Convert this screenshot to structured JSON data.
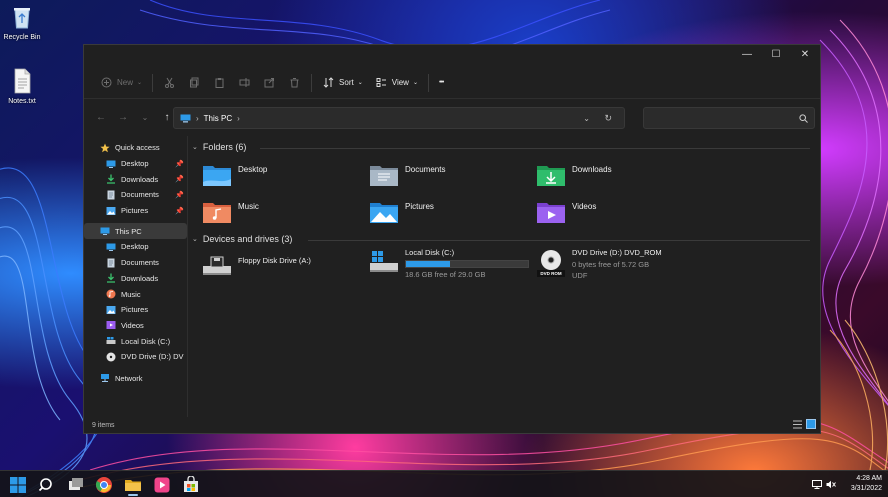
{
  "desktop": {
    "icons": [
      {
        "label": "Recycle Bin",
        "icon": "recycle-bin-icon"
      },
      {
        "label": "Notes.txt",
        "icon": "text-file-icon"
      }
    ]
  },
  "window": {
    "controls": {
      "minimize": "—",
      "maximize": "☐",
      "close": "✕"
    },
    "toolbar": {
      "new_label": "New",
      "sort_label": "Sort",
      "view_label": "View",
      "more_label": "•••"
    },
    "nav": {
      "back": "←",
      "forward": "→",
      "recent": "⌄",
      "up": "↑"
    },
    "address": {
      "chevron": "›",
      "location": "This PC",
      "trailing_chevron": "›",
      "dropdown": "⌄",
      "refresh": "↻"
    },
    "search": {
      "placeholder": "",
      "icon": "search-icon"
    },
    "sidebar": {
      "quick_access": {
        "label": "Quick access",
        "icon": "star-icon"
      },
      "quick_items": [
        {
          "label": "Desktop",
          "icon": "desktop-folder-icon",
          "pinned": true
        },
        {
          "label": "Downloads",
          "icon": "downloads-icon",
          "pinned": true
        },
        {
          "label": "Documents",
          "icon": "documents-icon",
          "pinned": true
        },
        {
          "label": "Pictures",
          "icon": "pictures-icon",
          "pinned": true
        }
      ],
      "this_pc": {
        "label": "This PC",
        "icon": "pc-icon"
      },
      "pc_items": [
        {
          "label": "Desktop",
          "icon": "desktop-folder-icon"
        },
        {
          "label": "Documents",
          "icon": "documents-icon"
        },
        {
          "label": "Downloads",
          "icon": "downloads-icon"
        },
        {
          "label": "Music",
          "icon": "music-icon"
        },
        {
          "label": "Pictures",
          "icon": "pictures-icon"
        },
        {
          "label": "Videos",
          "icon": "videos-icon"
        },
        {
          "label": "Local Disk (C:)",
          "icon": "drive-icon"
        },
        {
          "label": "DVD Drive (D:) DV",
          "icon": "dvd-icon"
        }
      ],
      "network": {
        "label": "Network",
        "icon": "network-icon"
      }
    },
    "folders": {
      "heading": "Folders (6)",
      "items": [
        {
          "label": "Desktop",
          "icon": "desktop-folder-icon"
        },
        {
          "label": "Documents",
          "icon": "documents-folder-icon"
        },
        {
          "label": "Downloads",
          "icon": "downloads-folder-icon"
        },
        {
          "label": "Music",
          "icon": "music-folder-icon"
        },
        {
          "label": "Pictures",
          "icon": "pictures-folder-icon"
        },
        {
          "label": "Videos",
          "icon": "videos-folder-icon"
        }
      ]
    },
    "drives": {
      "heading": "Devices and drives (3)",
      "items": [
        {
          "label": "Floppy Disk Drive (A:)",
          "icon": "floppy-drive-icon"
        },
        {
          "label": "Local Disk (C:)",
          "icon": "local-disk-icon",
          "free_text": "18.6 GB free of 29.0 GB",
          "used_fraction": 0.36
        },
        {
          "label": "DVD Drive (D:) DVD_ROM",
          "icon": "dvd-drive-icon",
          "free_text": "0 bytes free of 5.72 GB",
          "fs_text": "UDF",
          "badge": "DVD ROM"
        }
      ]
    },
    "status": {
      "items_count": "9 items"
    }
  },
  "taskbar": {
    "icons": [
      "start-icon",
      "search-icon",
      "task-view-icon",
      "chrome-icon",
      "file-explorer-icon",
      "media-player-icon",
      "store-icon"
    ],
    "time": "4:28 AM",
    "date": "3/31/2022",
    "tray_icons": [
      "network-tray-icon",
      "volume-icon"
    ]
  },
  "colors": {
    "accent": "#2d9ae8",
    "window_bg": "#202020",
    "folder_yellow": "#f3c24a"
  }
}
